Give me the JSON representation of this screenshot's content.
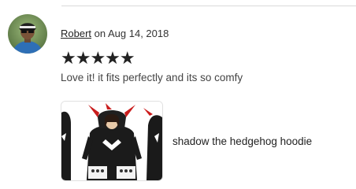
{
  "review": {
    "reviewer_name": "Robert",
    "date_text": "on Aug 14, 2018",
    "rating": 5,
    "rating_stars": "★★★★★",
    "text": "Love it! it fits perfectly and its so comfy",
    "item": {
      "title": "shadow the hedgehog hoodie"
    }
  },
  "colors": {
    "divider": "#d9d9d9",
    "text_primary": "#222222",
    "text_secondary": "#444444"
  },
  "icons": {
    "rating": "star-icon",
    "avatar": "user-avatar-photo"
  }
}
